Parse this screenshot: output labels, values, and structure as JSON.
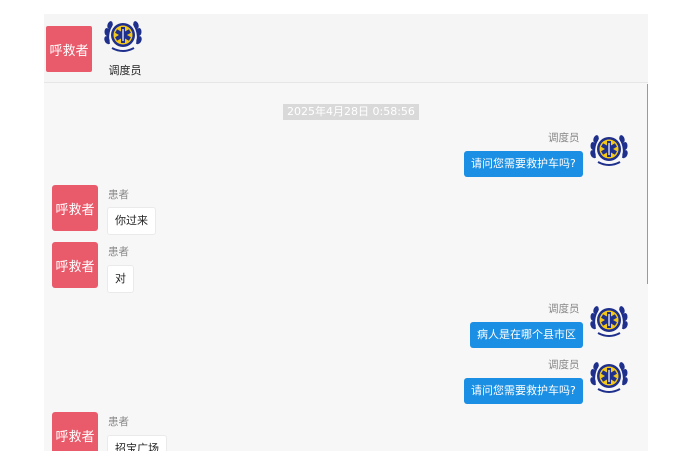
{
  "header": {
    "caller_label": "呼救者",
    "dispatcher_label": "调度员"
  },
  "chat": {
    "timestamp": "2025年4月28日 0:58:56",
    "messages": [
      {
        "role": "dispatcher",
        "name": "调度员",
        "text": "请问您需要救护车吗?"
      },
      {
        "role": "caller",
        "name": "患者",
        "badge": "呼救者",
        "text": "你过来"
      },
      {
        "role": "caller",
        "name": "患者",
        "badge": "呼救者",
        "text": "对"
      },
      {
        "role": "dispatcher",
        "name": "调度员",
        "text": "病人是在哪个县市区"
      },
      {
        "role": "dispatcher",
        "name": "调度员",
        "text": "请问您需要救护车吗?"
      },
      {
        "role": "caller",
        "name": "患者",
        "badge": "呼救者",
        "text": "招宝广场"
      }
    ]
  },
  "colors": {
    "caller_badge": "#e95b6b",
    "dispatcher_bubble": "#1a8fe3",
    "emblem_blue": "#1e2f8c",
    "emblem_yellow": "#f3c81a"
  },
  "icons": {
    "dispatcher_avatar": "ems-star-of-life-emblem-icon"
  }
}
